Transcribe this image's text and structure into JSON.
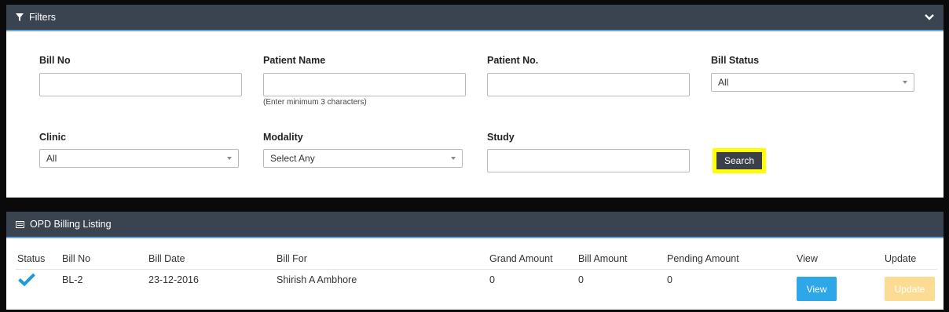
{
  "filters": {
    "title": "Filters",
    "bill_no": {
      "label": "Bill No",
      "value": ""
    },
    "patient_name": {
      "label": "Patient Name",
      "value": "",
      "help": "(Enter minimum 3 characters)"
    },
    "patient_no": {
      "label": "Patient No.",
      "value": ""
    },
    "bill_status": {
      "label": "Bill Status",
      "selected": "All"
    },
    "clinic": {
      "label": "Clinic",
      "selected": "All"
    },
    "modality": {
      "label": "Modality",
      "selected": "Select Any"
    },
    "study": {
      "label": "Study",
      "value": ""
    },
    "search_label": "Search",
    "highlight_color": "#ffff00"
  },
  "listing": {
    "title": "OPD Billing Listing",
    "columns": [
      "Status",
      "Bill No",
      "Bill Date",
      "Bill For",
      "Grand Amount",
      "Bill Amount",
      "Pending Amount",
      "View",
      "Update"
    ],
    "rows": [
      {
        "status_icon": "check-icon",
        "bill_no": "BL-2",
        "bill_date": "23-12-2016",
        "bill_for": "Shirish A Ambhore",
        "grand_amount": "0",
        "bill_amount": "0",
        "pending_amount": "0",
        "view_label": "View",
        "update_label": "Update"
      }
    ]
  },
  "colors": {
    "header_bg": "#3a4350",
    "accent_blue": "#2ea7e8",
    "update_yellow": "#fbd680",
    "check_color": "#1e9ad6"
  }
}
